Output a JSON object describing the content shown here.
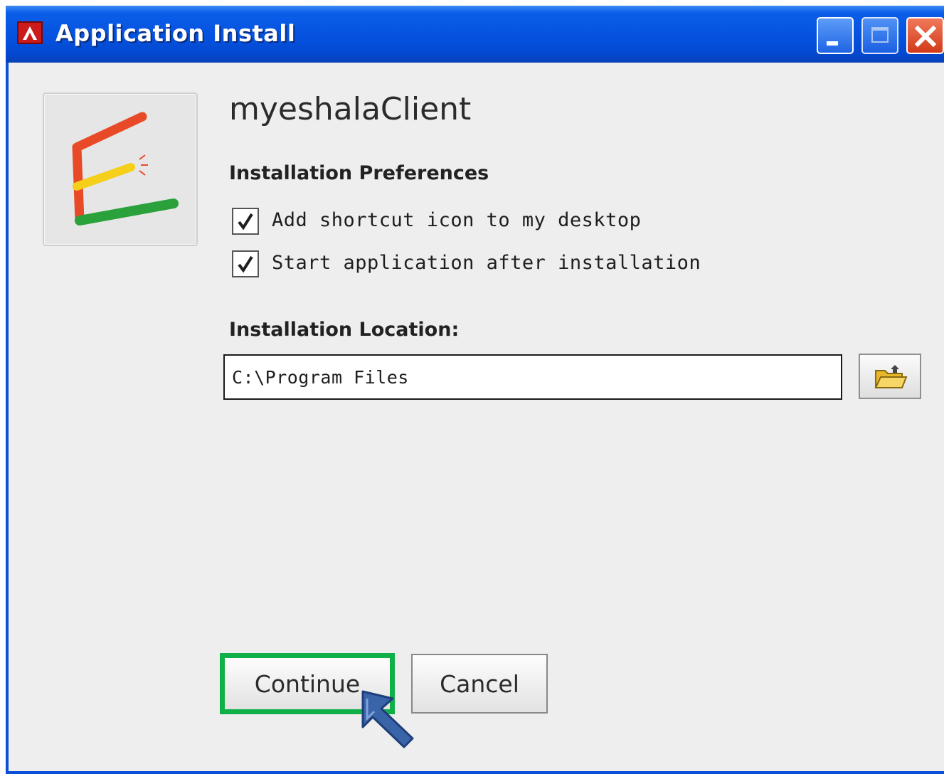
{
  "window": {
    "title": "Application Install",
    "title_icon": "adobe-air-icon",
    "controls": [
      "minimize-icon",
      "maximize-icon",
      "close-icon"
    ]
  },
  "app": {
    "name": "myeshalaClient",
    "logo": "e-logo-icon"
  },
  "preferences": {
    "heading": "Installation Preferences",
    "options": [
      {
        "label": "Add shortcut icon to my desktop",
        "checked": true
      },
      {
        "label": "Start application after installation",
        "checked": true
      }
    ]
  },
  "location": {
    "heading": "Installation Location:",
    "value": "C:\\Program Files",
    "browse_icon": "folder-open-icon"
  },
  "buttons": {
    "continue": "Continue",
    "cancel": "Cancel"
  },
  "annotation": {
    "highlight_color": "#10b048",
    "arrow_color": "#3a64a8"
  }
}
